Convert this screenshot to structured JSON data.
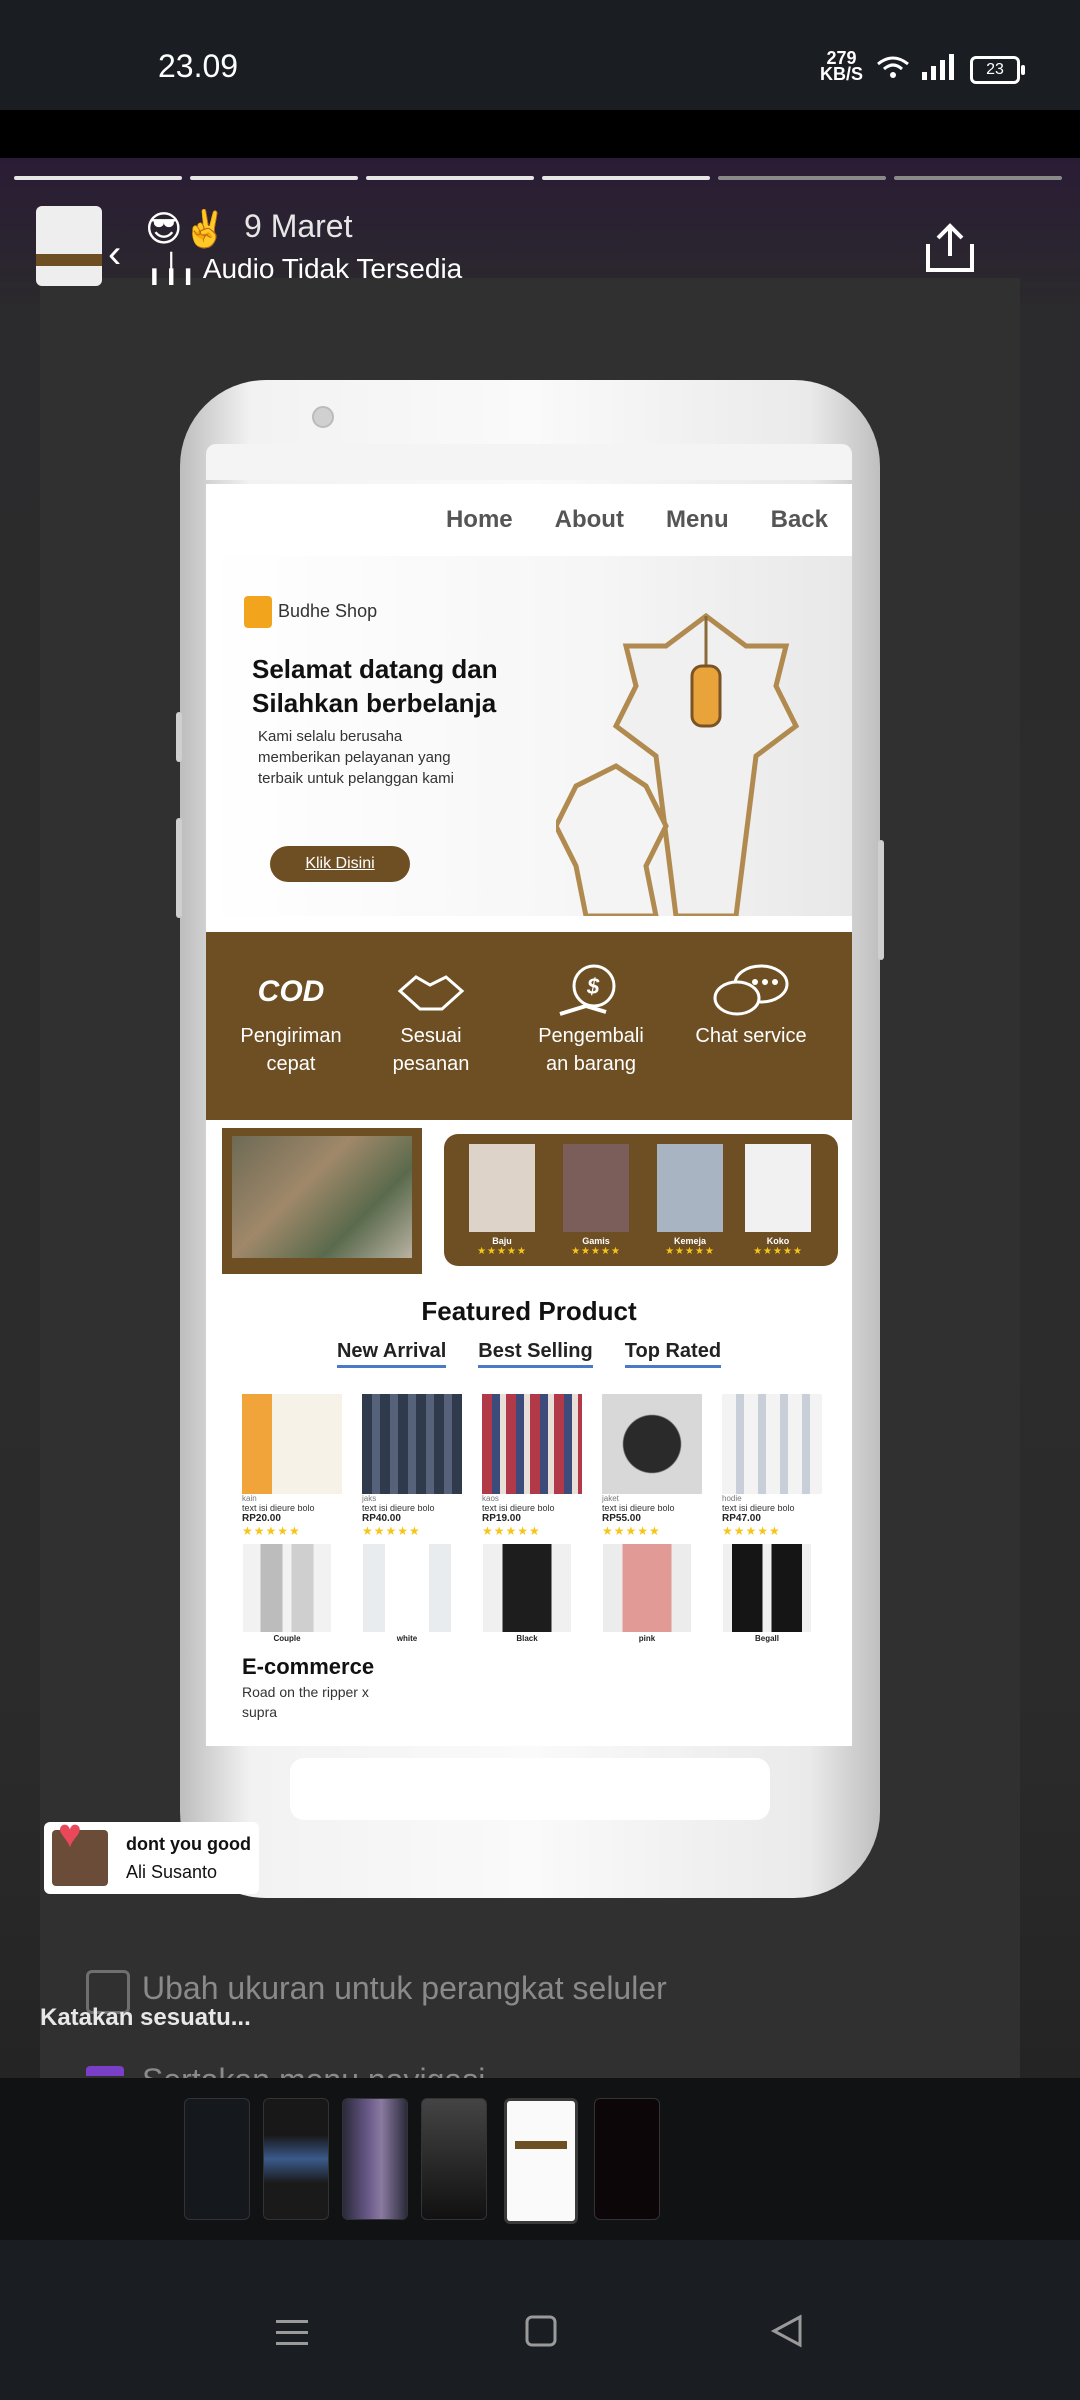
{
  "statusbar": {
    "time": "23.09",
    "net_speed": "279",
    "net_unit": "KB/S",
    "battery": "23"
  },
  "story_header": {
    "emoji": "😎✌️",
    "date": "9 Maret",
    "audio_status": "Audio Tidak Tersedia"
  },
  "site": {
    "nav": [
      "Home",
      "About",
      "Menu",
      "Back"
    ],
    "brand": "Budhe Shop",
    "hero_title": "Selamat datang dan Silahkan berbelanja",
    "hero_desc": "Kami selalu berusaha memberikan pelayanan yang terbaik untuk pelanggan kami",
    "cta": "Klik Disini",
    "features": [
      {
        "icon": "cod-truck-icon",
        "icon_text": "COD",
        "label": "Pengiriman cepat"
      },
      {
        "icon": "handshake-icon",
        "label": "Sesuai pesanan"
      },
      {
        "icon": "money-return-icon",
        "label": "Pengembali an barang"
      },
      {
        "icon": "chat-icon",
        "label": "Chat service"
      }
    ],
    "categories": [
      {
        "label": "Baju",
        "stars": "★★★★★"
      },
      {
        "label": "Gamis",
        "stars": "★★★★★"
      },
      {
        "label": "Kemeja",
        "stars": "★★★★★"
      },
      {
        "label": "Koko",
        "stars": "★★★★★"
      }
    ],
    "featured_title": "Featured Product",
    "tabs": [
      "New Arrival",
      "Best Selling",
      "Top Rated"
    ],
    "products": [
      {
        "name": "kain",
        "desc": "text isi dieure bolo",
        "price": "RP20.00",
        "stars": "★★★★★",
        "color": "#e9a33a"
      },
      {
        "name": "jaks",
        "desc": "text isi dieure bolo",
        "price": "RP40.00",
        "stars": "★★★★★",
        "color": "#3c4656"
      },
      {
        "name": "kaos",
        "desc": "text isi dieure bolo",
        "price": "RP19.00",
        "stars": "★★★★★",
        "color": "#9b3a46"
      },
      {
        "name": "jaket",
        "desc": "text isi dieure bolo",
        "price": "RP55.00",
        "stars": "★★★★★",
        "color": "#2e2e2e"
      },
      {
        "name": "hodie",
        "desc": "text isi dieure bolo",
        "price": "RP47.00",
        "stars": "★★★★★",
        "color": "#d8d8d8"
      }
    ],
    "models": [
      {
        "label": "Couple",
        "color": "#cfcfcf"
      },
      {
        "label": "white",
        "color": "#e7e7e7"
      },
      {
        "label": "Black",
        "color": "#1f1f1f"
      },
      {
        "label": "pink",
        "color": "#e29a96"
      },
      {
        "label": "Begall",
        "color": "#151515"
      }
    ],
    "footer_title": "E-commerce",
    "footer_sub": "Road on the ripper x supra"
  },
  "notification": {
    "title": "dont you good",
    "artist": "Ali Susanto"
  },
  "ghost_text": {
    "checkbox_label": "Ubah ukuran untuk perangkat seluler",
    "bottom_label": "Sertakan menu navigasi"
  },
  "reply_placeholder": "Katakan sesuatu...",
  "accent_colors": {
    "brown": "#6e4f23",
    "star": "#f5c518"
  }
}
